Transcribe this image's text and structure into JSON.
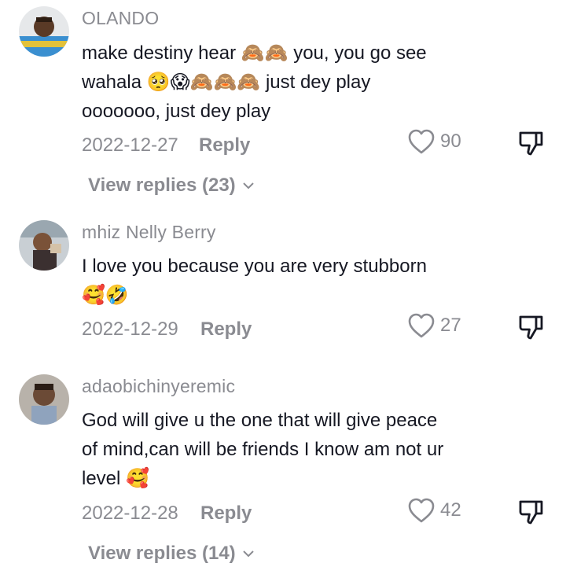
{
  "comments": [
    {
      "username": "OLANDO",
      "lines": [
        "make destiny hear 🙈🙈 you, you go see",
        "wahala 🥺😱🙈🙈🙈 just dey play",
        "ooooooo, just dey play"
      ],
      "date": "2022-12-27",
      "reply_label": "Reply",
      "likes": "90",
      "view_replies": "View replies (23)"
    },
    {
      "username": "mhiz Nelly Berry",
      "lines": [
        "I love you because you are very stubborn",
        "🥰🤣"
      ],
      "date": "2022-12-29",
      "reply_label": "Reply",
      "likes": "27"
    },
    {
      "username": "adaobichinyeremic",
      "lines": [
        "God will give u the one that will give peace",
        "of mind,can will be friends I know am not ur",
        "level 🥰"
      ],
      "date": "2022-12-28",
      "reply_label": "Reply",
      "likes": "42",
      "view_replies": "View replies (14)"
    }
  ],
  "icons": {
    "like": "heart-outline-icon",
    "dislike": "thumbs-down-outline-icon",
    "expand": "chevron-down-icon"
  },
  "colors": {
    "text": "#161823",
    "muted": "#8a8b91",
    "background": "#ffffff"
  }
}
